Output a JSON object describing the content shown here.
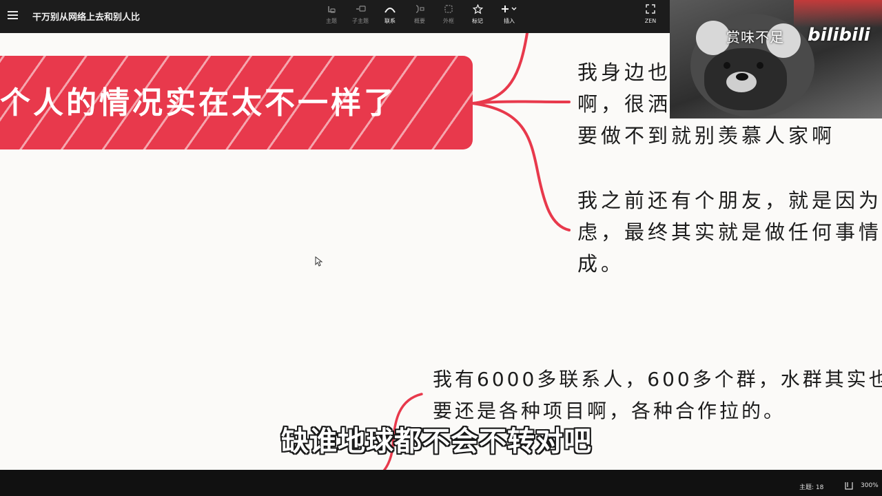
{
  "app": {
    "title": "干万别从网络上去和别人比",
    "menu_icon": "hamburger-menu-icon"
  },
  "toolbar": {
    "items": [
      {
        "label": "主题",
        "icon": "topic-icon",
        "active": false
      },
      {
        "label": "子主题",
        "icon": "subtopic-icon",
        "active": false
      },
      {
        "label": "联系",
        "icon": "relationship-icon",
        "active": true
      },
      {
        "label": "概要",
        "icon": "summary-icon",
        "active": false
      },
      {
        "label": "外框",
        "icon": "boundary-icon",
        "active": false
      },
      {
        "label": "标记",
        "icon": "star-icon",
        "active": true
      },
      {
        "label": "插入",
        "icon": "plus-icon",
        "active": true
      }
    ],
    "zen_label": "ZEN"
  },
  "canvas": {
    "central_topic": "个人的情况实在太不一样了",
    "notes": [
      {
        "lines": [
          "我身边也",
          "啊，很洒",
          "要做不到就别羡慕人家啊"
        ]
      },
      {
        "lines": [
          "我之前还有个朋友，就是因为",
          "虑，最终其实就是做任何事情",
          "成。"
        ]
      },
      {
        "lines": [
          "我有6000多联系人，600多个群，水群其实也",
          "要还是各种项目啊，各种合作拉的。"
        ]
      }
    ],
    "accent_color": "#e8394c"
  },
  "webcam": {
    "channel_name": "赏味不足",
    "watermark": "bilibili"
  },
  "subtitle": "缺谁地球都不会不转对吧",
  "status": {
    "topic_count": "主题: 18",
    "zoom": "300%"
  }
}
